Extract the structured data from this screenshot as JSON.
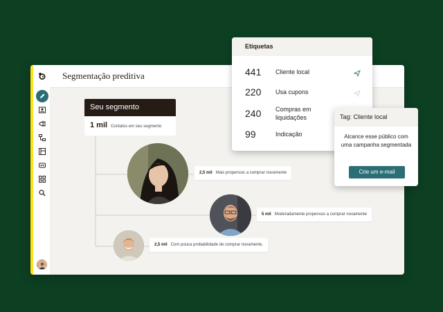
{
  "app": {
    "page_title": "Segmentação preditiva"
  },
  "sidebar": {
    "items": [
      {
        "icon": "pencil-icon",
        "active": true
      },
      {
        "icon": "audience-icon"
      },
      {
        "icon": "megaphone-icon"
      },
      {
        "icon": "automation-icon"
      },
      {
        "icon": "content-icon"
      },
      {
        "icon": "analytics-icon"
      },
      {
        "icon": "grid-icon"
      },
      {
        "icon": "search-icon"
      }
    ],
    "accent": "#ffe01b"
  },
  "segment": {
    "title": "Seu segmento",
    "count": "1 mil",
    "count_desc": "Contatos em seu segmento"
  },
  "branches": [
    {
      "value": "2,5 mil",
      "text": "Mais propensos a comprar novamente"
    },
    {
      "value": "5 mil",
      "text": "Moderadamente propensos a comprar novamente"
    },
    {
      "value": "2,5 mil",
      "text": "Com pouca probabilidade de comprar novamente."
    }
  ],
  "tags": {
    "title": "Etiquetas",
    "rows": [
      {
        "num": "441",
        "label": "Cliente local",
        "icon": "send-icon",
        "icon_active": true
      },
      {
        "num": "220",
        "label": "Usa cupons",
        "icon": "send-icon",
        "icon_active": false
      },
      {
        "num": "240",
        "label": "Compras em liquidações",
        "icon": "",
        "icon_active": false
      },
      {
        "num": "99",
        "label": "Indicação",
        "icon": "",
        "icon_active": false
      }
    ]
  },
  "cta": {
    "title": "Tag: Cliente local",
    "text": "Alcance esse público com uma campanha segmentada",
    "button": "Crie um e-mail",
    "button_color": "#2b6e75"
  },
  "colors": {
    "background": "#0d3f23",
    "dark_header": "#241c15",
    "active_icon": "#2b6e75"
  }
}
